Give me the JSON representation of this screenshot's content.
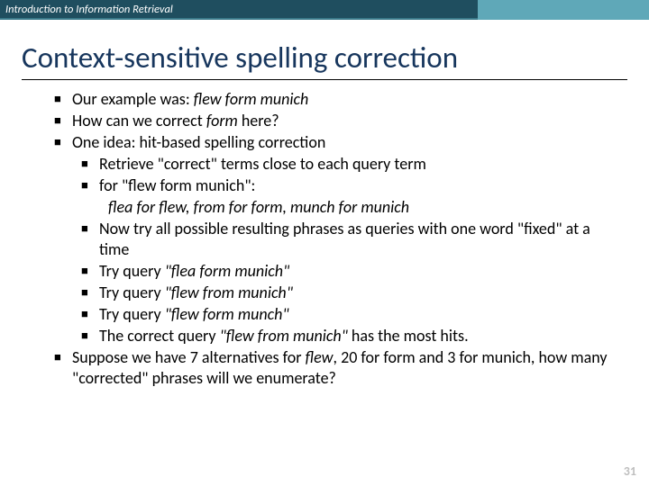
{
  "header": "Introduction to Information Retrieval",
  "title": "Context-sensitive spelling correction",
  "b1a": "Our example was: ",
  "b1b": "flew form munich",
  "b2a": "How can we correct ",
  "b2b": "form",
  "b2c": " here?",
  "b3": "One idea: hit-based spelling correction",
  "s1": "Retrieve \"correct\" terms close to each query term",
  "s2a": "for \"flew form munich\":",
  "s2b": "flea for flew, from for form, munch for munich",
  "s3": "Now try all possible resulting phrases as queries with one word \"fixed\" at a time",
  "s4a": "Try query ",
  "s4b": "\"flea form munich\"",
  "s5a": "Try query ",
  "s5b": "\"flew from munich\"",
  "s6a": "Try query ",
  "s6b": "\"flew form munch\"",
  "s7a": "The correct query ",
  "s7b": "\"flew from munich\"",
  "s7c": " has the most hits.",
  "b4a": "Suppose we have 7 alternatives for ",
  "b4b": "flew",
  "b4c": ", 20 for form and 3 for munich, how many \"corrected\" phrases will we enumerate?",
  "page": "31"
}
